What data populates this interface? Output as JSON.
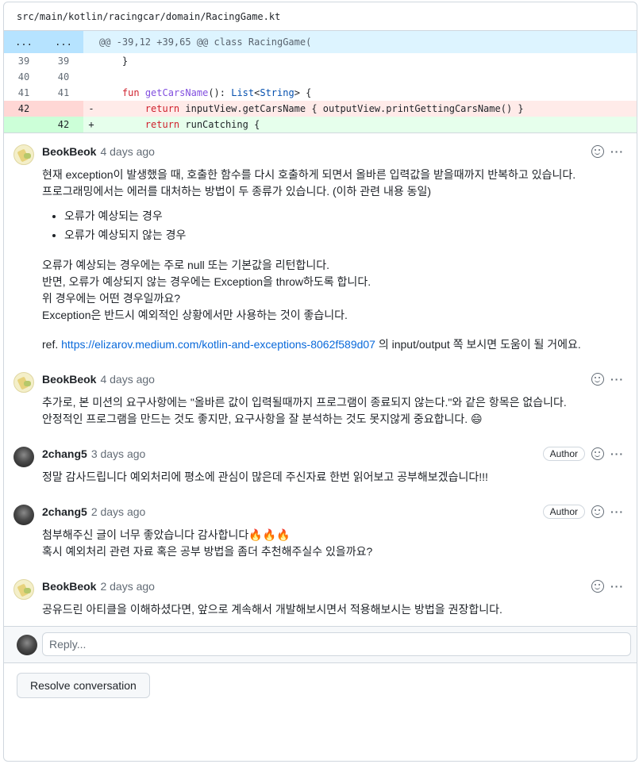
{
  "file": {
    "path": "src/main/kotlin/racingcar/domain/RacingGame.kt"
  },
  "diff": {
    "hunk": {
      "left": "...",
      "right": "...",
      "text": "@@ -39,12 +39,65 @@ class RacingGame("
    },
    "lines": [
      {
        "type": "context",
        "old": "39",
        "new": "39",
        "sign": "",
        "code": "    }"
      },
      {
        "type": "context",
        "old": "40",
        "new": "40",
        "sign": "",
        "code": ""
      },
      {
        "type": "context",
        "old": "41",
        "new": "41",
        "sign": "",
        "code": "    fun getCarsName(): List<String> {"
      },
      {
        "type": "del",
        "old": "42",
        "new": "",
        "sign": "-",
        "code": "        return inputView.getCarsName { outputView.printGettingCarsName() }"
      },
      {
        "type": "add",
        "old": "",
        "new": "42",
        "sign": "+",
        "code": "        return runCatching {"
      }
    ]
  },
  "comments": [
    {
      "author": "BeokBeok",
      "time": "4 days ago",
      "badge": "",
      "line1": "현재 exception이 발생했을 때, 호출한 함수를 다시 호출하게 되면서 올바른 입력값을 받을때까지 반복하고 있습니다.",
      "line2": "프로그래밍에서는 에러를 대처하는 방법이 두 종류가 있습니다. (이하 관련 내용 동일)",
      "bullets": [
        "오류가 예상되는 경우",
        "오류가 예상되지 않는 경우"
      ],
      "line3": "오류가 예상되는 경우에는 주로 null 또는 기본값을 리턴합니다.",
      "line4": "반면, 오류가 예상되지 않는 경우에는 Exception을 throw하도록 합니다.",
      "line5": "위 경우에는 어떤 경우일까요?",
      "line6": "Exception은 반드시 예외적인 상황에서만 사용하는 것이 좋습니다.",
      "ref_prefix": "ref.",
      "ref_link": "https://elizarov.medium.com/kotlin-and-exceptions-8062f589d07",
      "ref_suffix": "의 input/output 쪽 보시면 도움이 될 거에요."
    },
    {
      "author": "BeokBeok",
      "time": "4 days ago",
      "badge": "",
      "line1": "추가로, 본 미션의 요구사항에는 \"올바른 값이 입력될때까지 프로그램이 종료되지 않는다.\"와 같은 항목은 없습니다.",
      "line2": "안정적인 프로그램을 만드는 것도 좋지만, 요구사항을 잘 분석하는 것도 못지않게 중요합니다. 😄"
    },
    {
      "author": "2chang5",
      "time": "3 days ago",
      "badge": "Author",
      "line1": "정말 감사드립니다 예외처리에 평소에 관심이 많은데 주신자료 한번 읽어보고 공부해보겠습니다!!!"
    },
    {
      "author": "2chang5",
      "time": "2 days ago",
      "badge": "Author",
      "line1": "첨부해주신 글이 너무 좋았습니다 감사합니다🔥🔥🔥",
      "line2": "혹시 예외처리 관련 자료 혹은 공부 방법을 좀더 추천해주실수 있을까요?"
    },
    {
      "author": "BeokBeok",
      "time": "2 days ago",
      "badge": "",
      "line1": "공유드린 아티클을 이해하셨다면, 앞으로 계속해서 개발해보시면서 적용해보시는 방법을 권장합니다."
    }
  ],
  "reply": {
    "placeholder": "Reply..."
  },
  "resolve": {
    "label": "Resolve conversation"
  },
  "icons": {
    "reaction": "smiley-icon",
    "menu": "kebab-horizontal-icon"
  }
}
